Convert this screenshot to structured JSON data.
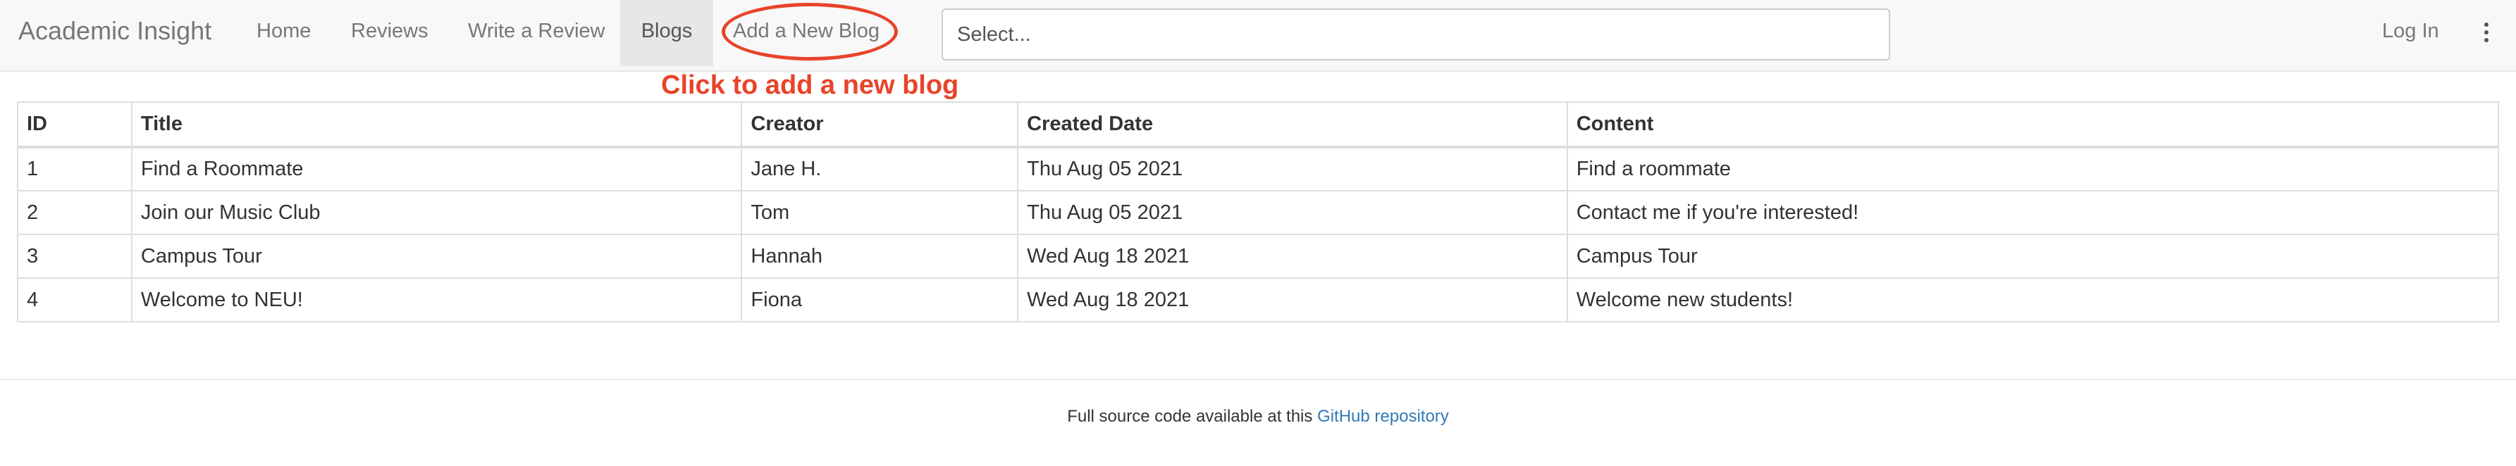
{
  "navbar": {
    "brand": "Academic Insight",
    "links": {
      "home": "Home",
      "reviews": "Reviews",
      "write_review": "Write a Review",
      "blogs": "Blogs",
      "add_blog": "Add a New Blog"
    },
    "select": {
      "placeholder": "Select..."
    },
    "login": "Log In",
    "menu_icon": "kebab-menu-icon"
  },
  "annotation": {
    "text": "Click to add a new blog",
    "color": "#e8442a"
  },
  "table": {
    "headers": {
      "id": "ID",
      "title": "Title",
      "creator": "Creator",
      "created_date": "Created Date",
      "content": "Content"
    },
    "rows": [
      {
        "id": "1",
        "title": "Find a Roommate",
        "creator": "Jane H.",
        "created_date": "Thu Aug 05 2021",
        "content": "Find a roommate"
      },
      {
        "id": "2",
        "title": "Join our Music Club",
        "creator": "Tom",
        "created_date": "Thu Aug 05 2021",
        "content": "Contact me if you're interested!"
      },
      {
        "id": "3",
        "title": "Campus Tour",
        "creator": "Hannah",
        "created_date": "Wed Aug 18 2021",
        "content": "Campus Tour"
      },
      {
        "id": "4",
        "title": "Welcome to NEU!",
        "creator": "Fiona",
        "created_date": "Wed Aug 18 2021",
        "content": "Welcome new students!"
      }
    ]
  },
  "footer": {
    "text": "Full source code available at this ",
    "link_text": "GitHub repository",
    "link_color": "#337ab7"
  }
}
